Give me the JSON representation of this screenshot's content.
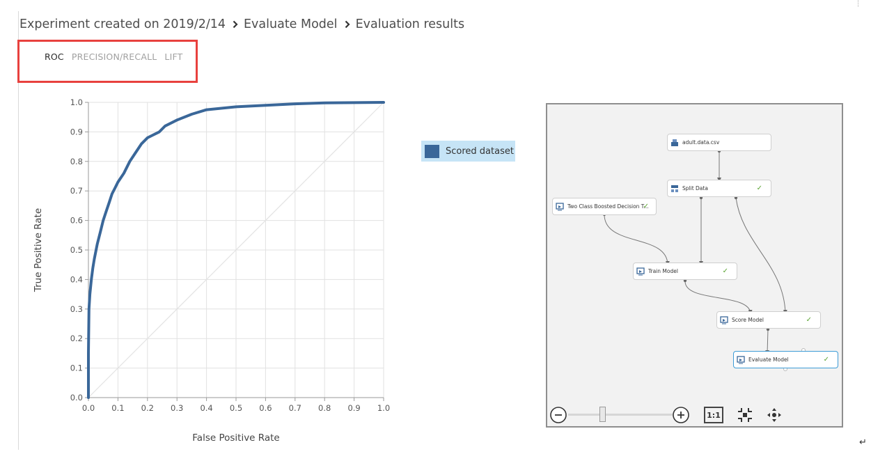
{
  "breadcrumb": {
    "items": [
      "Experiment created on 2019/2/14",
      "Evaluate Model",
      "Evaluation results"
    ]
  },
  "tabs": [
    {
      "label": "ROC",
      "active": true
    },
    {
      "label": "PRECISION/RECALL",
      "active": false
    },
    {
      "label": "LIFT",
      "active": false
    }
  ],
  "colors": {
    "accent": "#3a6799",
    "highlight_border": "#e8413e",
    "legend_bg": "#c6e4f6",
    "check": "#5aa532",
    "selected_node": "#3c9bd6"
  },
  "legend": {
    "label": "Scored dataset"
  },
  "chart_data": {
    "type": "line",
    "title": "",
    "xlabel": "False Positive Rate",
    "ylabel": "True Positive Rate",
    "xlim": [
      0.0,
      1.0
    ],
    "ylim": [
      0.0,
      1.0
    ],
    "xticks": [
      "0.0",
      "0.1",
      "0.2",
      "0.3",
      "0.4",
      "0.5",
      "0.6",
      "0.7",
      "0.8",
      "0.9",
      "1.0"
    ],
    "yticks": [
      "0.0",
      "0.1",
      "0.2",
      "0.3",
      "0.4",
      "0.5",
      "0.6",
      "0.7",
      "0.8",
      "0.9",
      "1.0"
    ],
    "grid": true,
    "legend_position": "right",
    "series": [
      {
        "name": "Scored dataset",
        "color": "#3a6799",
        "x": [
          0.0,
          0.0,
          0.002,
          0.005,
          0.01,
          0.015,
          0.02,
          0.03,
          0.04,
          0.05,
          0.06,
          0.07,
          0.08,
          0.09,
          0.1,
          0.12,
          0.14,
          0.16,
          0.18,
          0.2,
          0.22,
          0.24,
          0.26,
          0.3,
          0.35,
          0.4,
          0.45,
          0.5,
          0.6,
          0.7,
          0.8,
          0.9,
          1.0
        ],
        "y": [
          0.0,
          0.15,
          0.3,
          0.35,
          0.4,
          0.44,
          0.47,
          0.52,
          0.56,
          0.6,
          0.63,
          0.66,
          0.69,
          0.71,
          0.73,
          0.76,
          0.8,
          0.83,
          0.86,
          0.88,
          0.89,
          0.9,
          0.92,
          0.94,
          0.96,
          0.975,
          0.98,
          0.985,
          0.99,
          0.995,
          0.998,
          0.999,
          1.0
        ]
      },
      {
        "name": "",
        "color": "#e3e3e3",
        "x": [
          0.0,
          1.0
        ],
        "y": [
          0.0,
          1.0
        ]
      }
    ]
  },
  "workflow": {
    "nodes": [
      {
        "id": "adult",
        "label": "adult.data.csv",
        "icon": "dataset-icon",
        "check": false,
        "selected": false
      },
      {
        "id": "split",
        "label": "Split Data",
        "icon": "split-data-icon",
        "check": true,
        "selected": false
      },
      {
        "id": "boost",
        "label": "Two Class Boosted Decision T...",
        "icon": "model-icon",
        "check": true,
        "selected": false
      },
      {
        "id": "train",
        "label": "Train Model",
        "icon": "model-icon",
        "check": true,
        "selected": false
      },
      {
        "id": "score",
        "label": "Score Model",
        "icon": "model-icon",
        "check": true,
        "selected": false
      },
      {
        "id": "evaluate",
        "label": "Evaluate Model",
        "icon": "model-icon",
        "check": true,
        "selected": true
      }
    ],
    "check_mark": "✓"
  },
  "canvas_controls": {
    "zoom_out": "zoom-out-icon",
    "zoom_in": "zoom-in-icon",
    "actual_size_label": "1:1",
    "fit": "fit-to-screen-icon",
    "pan": "pan-icon",
    "zoom_level": 0.1
  },
  "misc": {
    "return_glyph": "↵"
  }
}
